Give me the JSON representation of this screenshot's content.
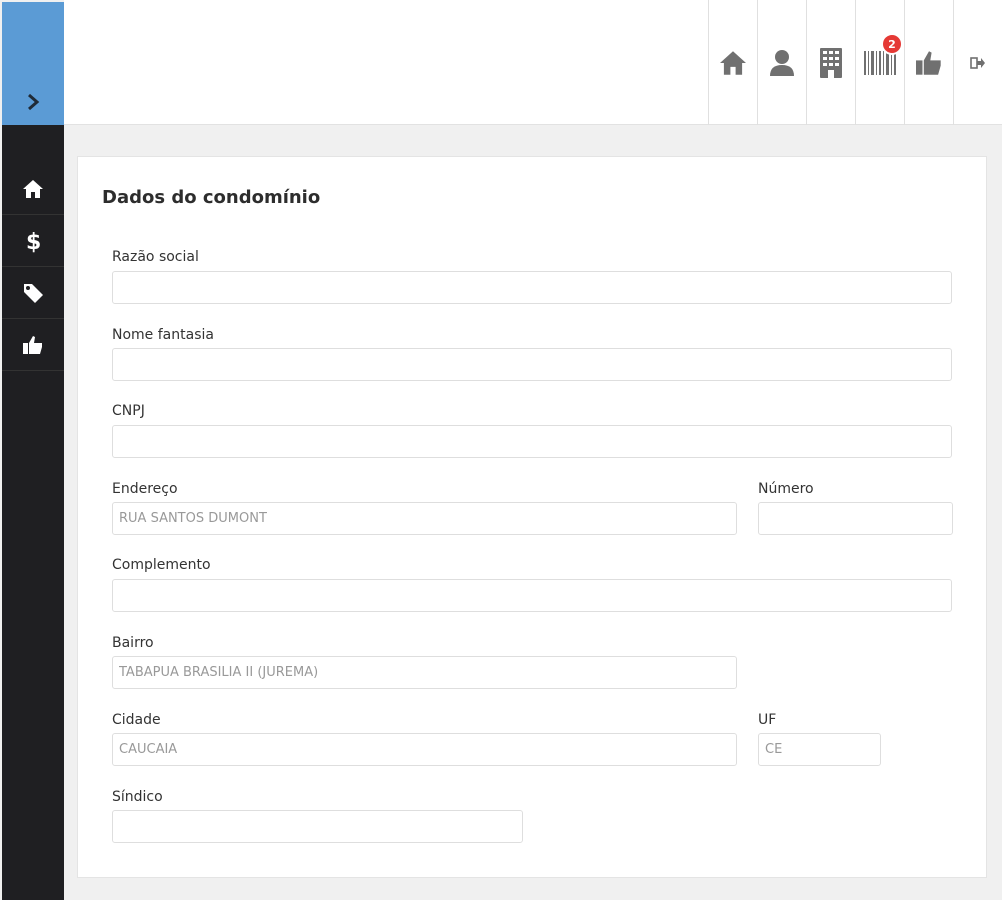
{
  "sidebar": {
    "toggle_icon": "chevron-right-icon",
    "items": [
      {
        "icon": "home-icon"
      },
      {
        "icon": "dollar-icon"
      },
      {
        "icon": "tag-icon"
      },
      {
        "icon": "thumbs-up-icon"
      }
    ]
  },
  "topbar": {
    "items": [
      {
        "icon": "home-icon"
      },
      {
        "icon": "user-icon"
      },
      {
        "icon": "building-icon"
      },
      {
        "icon": "barcode-icon",
        "badge": "2"
      },
      {
        "icon": "thumbs-up-icon"
      },
      {
        "icon": "logout-icon"
      }
    ]
  },
  "form": {
    "title": "Dados do condomínio",
    "razao_social": {
      "label": "Razão social",
      "value": ""
    },
    "nome_fantasia": {
      "label": "Nome fantasia",
      "value": ""
    },
    "cnpj": {
      "label": "CNPJ",
      "value": ""
    },
    "endereco": {
      "label": "Endereço",
      "value": "RUA SANTOS DUMONT"
    },
    "numero": {
      "label": "Número",
      "value": ""
    },
    "complemento": {
      "label": "Complemento",
      "value": ""
    },
    "bairro": {
      "label": "Bairro",
      "value": "TABAPUA BRASILIA II (JUREMA)"
    },
    "cidade": {
      "label": "Cidade",
      "value": "CAUCAIA"
    },
    "uf": {
      "label": "UF",
      "value": "CE"
    },
    "sindico": {
      "label": "Síndico",
      "value": ""
    }
  },
  "colors": {
    "sidebar_accent": "#5b9bd5",
    "sidebar_bg": "#1f1f22",
    "badge": "#e53935"
  }
}
